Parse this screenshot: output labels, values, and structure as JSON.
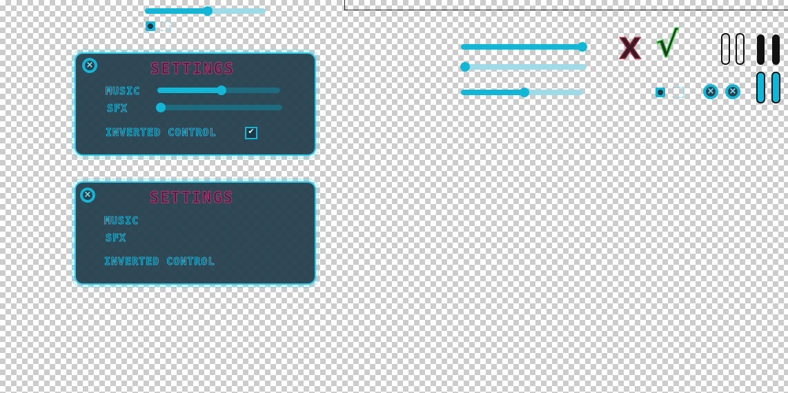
{
  "panels": [
    {
      "title": "SETTINGS",
      "music_label": "MUSIC",
      "sfx_label": "SFX",
      "inverted_label": "INVERTED CONTROL",
      "checkbox_mark": "✔",
      "music_level": 0.52,
      "sfx_level": 0.0
    },
    {
      "title": "SETTINGS",
      "music_label": "MUSIC",
      "sfx_label": "SFX",
      "inverted_label": "INVERTED CONTROL"
    }
  ],
  "glyphs": {
    "close": "×",
    "cross": "X",
    "check": "√"
  },
  "sliders": {
    "top_left": 0.52,
    "right_1": 1.0,
    "right_2": 0.0,
    "right_3": 0.52
  },
  "colors": {
    "accent": "#12b6d6",
    "title": "#b0356e",
    "panel": "#26404f",
    "cross": "#6a1b2a",
    "check": "#3fbf4a"
  },
  "icons": [
    "close-icon",
    "pause-icon",
    "checkmark-icon",
    "cross-icon"
  ]
}
